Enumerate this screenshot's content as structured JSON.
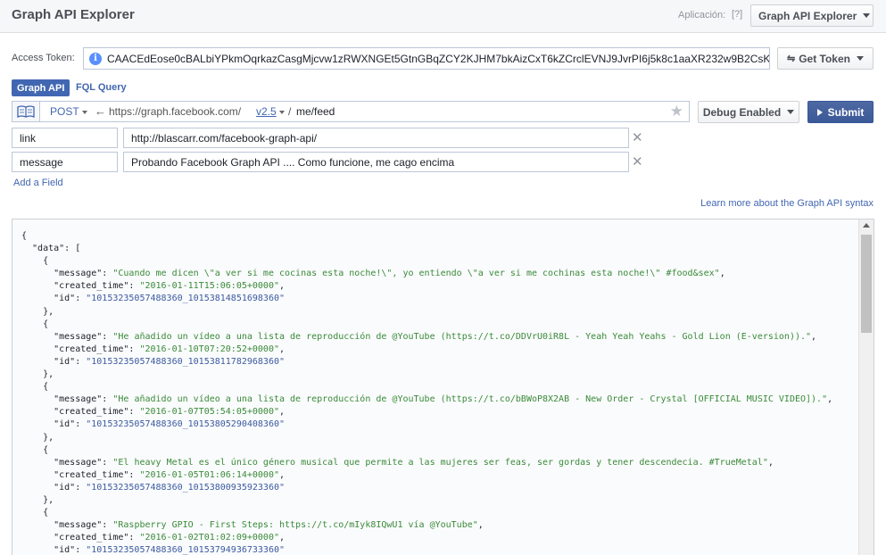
{
  "header": {
    "title": "Graph API Explorer",
    "app_label": "Aplicación:",
    "help": "[?]",
    "app_select": "Graph API Explorer"
  },
  "token": {
    "label": "Access Token:",
    "value": "CAACEdEose0cBALbiYPkmOqrkazCasgMjcvw1zRWXNGEt5GtnGBqZCY2KJHM7bkAizCxT6kZCrclEVNJ9JvrPI6j5k8c1aaXR232w9B2CsK",
    "get_token": "Get Token"
  },
  "tabs": {
    "graph": "Graph API",
    "fql": "FQL Query"
  },
  "request": {
    "method": "POST",
    "arrow": "←",
    "base_url": "https://graph.facebook.com/",
    "version": "v2.5",
    "sep": "/",
    "path": "me/feed",
    "debug": "Debug Enabled",
    "submit": "Submit"
  },
  "fields": [
    {
      "name": "link",
      "value": "http://blascarr.com/facebook-graph-api/"
    },
    {
      "name": "message",
      "value": "Probando Facebook Graph API .... Como funcione, me cago encima"
    }
  ],
  "add_field": "Add a Field",
  "learn_more": "Learn more about the Graph API syntax",
  "result": {
    "items": [
      {
        "message": "\"Cuando me dicen \\\"a ver si me cocinas esta noche!\\\", yo entiendo \\\"a ver si me cochinas esta noche!\\\" #food&sex\"",
        "created_time": "\"2016-01-11T15:06:05+0000\"",
        "id": "\"10153235057488360_10153814851698360\""
      },
      {
        "message": "\"He añadido un vídeo a una lista de reproducción de @YouTube (https://t.co/DDVrU0iR8L - Yeah Yeah Yeahs - Gold Lion (E-version)).\"",
        "created_time": "\"2016-01-10T07:20:52+0000\"",
        "id": "\"10153235057488360_10153811782968360\""
      },
      {
        "message": "\"He añadido un vídeo a una lista de reproducción de @YouTube (https://t.co/bBWoP8X2AB - New Order - Crystal [OFFICIAL MUSIC VIDEO]).\"",
        "created_time": "\"2016-01-07T05:54:05+0000\"",
        "id": "\"10153235057488360_10153805290408360\""
      },
      {
        "message": "\"El heavy Metal es el único género musical que permite a las mujeres ser feas, ser gordas y tener descendecia. #TrueMetal\"",
        "created_time": "\"2016-01-05T01:06:14+0000\"",
        "id": "\"10153235057488360_10153800935923360\""
      },
      {
        "message": "\"Raspberry GPIO - First Steps: https://t.co/mIyk8IQwU1 vía @YouTube\"",
        "created_time": "\"2016-01-02T01:02:09+0000\"",
        "id": "\"10153235057488360_10153794936733360\""
      }
    ]
  }
}
